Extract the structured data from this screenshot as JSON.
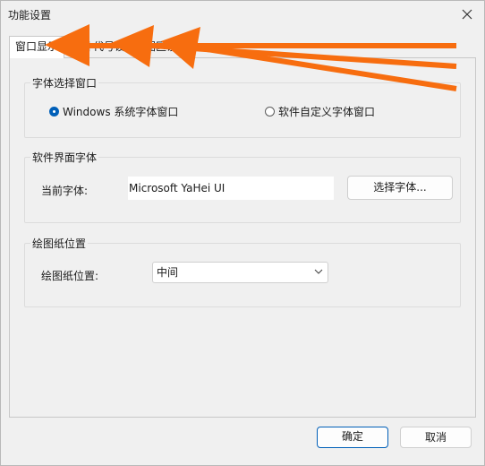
{
  "window": {
    "title": "功能设置"
  },
  "tabs": [
    {
      "label": "窗口显示"
    },
    {
      "label": "软件代号设置"
    },
    {
      "label": "绘图区设置"
    }
  ],
  "font_window_group": {
    "label": "字体选择窗口",
    "options": [
      {
        "label": "Windows 系统字体窗口",
        "selected": true
      },
      {
        "label": "软件自定义字体窗口",
        "selected": false
      }
    ]
  },
  "ui_font_group": {
    "label": "软件界面字体",
    "current_label": "当前字体:",
    "current_value": "Microsoft YaHei UI",
    "choose_button": "选择字体..."
  },
  "drawing_paper_group": {
    "label": "绘图纸位置",
    "field_label": "绘图纸位置:",
    "selected": "中间"
  },
  "footer": {
    "ok": "确定",
    "cancel": "取消"
  },
  "annotation": {
    "arrow_color": "#f76d0f",
    "arrow_count": 3
  },
  "colors": {
    "accent": "#005fb8"
  }
}
